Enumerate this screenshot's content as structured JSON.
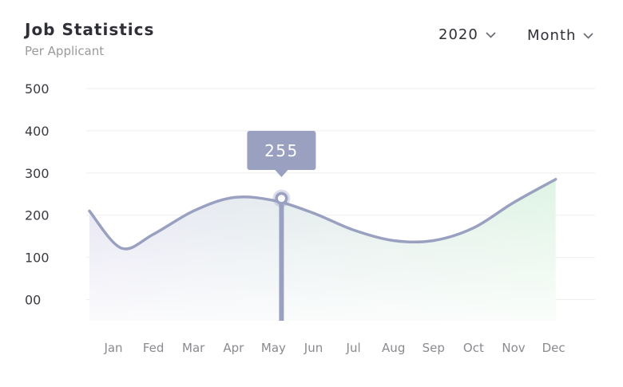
{
  "header": {
    "title": "Job Statistics",
    "subtitle": "Per Applicant",
    "year_select": "2020",
    "period_select": "Month"
  },
  "colors": {
    "line": "#9aa0c0",
    "fill_left": "#e4e3f2",
    "fill_right": "#dff4e4",
    "tooltip_bg": "#9aa0c0",
    "grid": "#eeeeee"
  },
  "icons": {
    "year_chevron": "chevron-down-icon",
    "period_chevron": "chevron-down-icon"
  },
  "chart_data": {
    "type": "area",
    "categories": [
      "Jan",
      "Fed",
      "Mar",
      "Apr",
      "May",
      "Jun",
      "Jul",
      "Aug",
      "Sep",
      "Oct",
      "Nov",
      "Dec"
    ],
    "values": [
      210,
      122,
      155,
      210,
      242,
      235,
      205,
      165,
      140,
      140,
      170,
      230,
      285
    ],
    "x_index": [
      -0.6,
      0.2,
      1.0,
      2.0,
      3.0,
      4.0,
      5.0,
      6.0,
      7.0,
      8.0,
      9.0,
      10.0,
      11.05
    ],
    "ytick_labels": [
      "500",
      "400",
      "300",
      "200",
      "100",
      "00"
    ],
    "ytick_values": [
      500,
      400,
      300,
      200,
      100,
      0
    ],
    "ylim": [
      -50,
      500
    ],
    "grid": true,
    "tooltip": {
      "category": "May",
      "x_index": 4.2,
      "value": 240,
      "label": "255"
    }
  }
}
